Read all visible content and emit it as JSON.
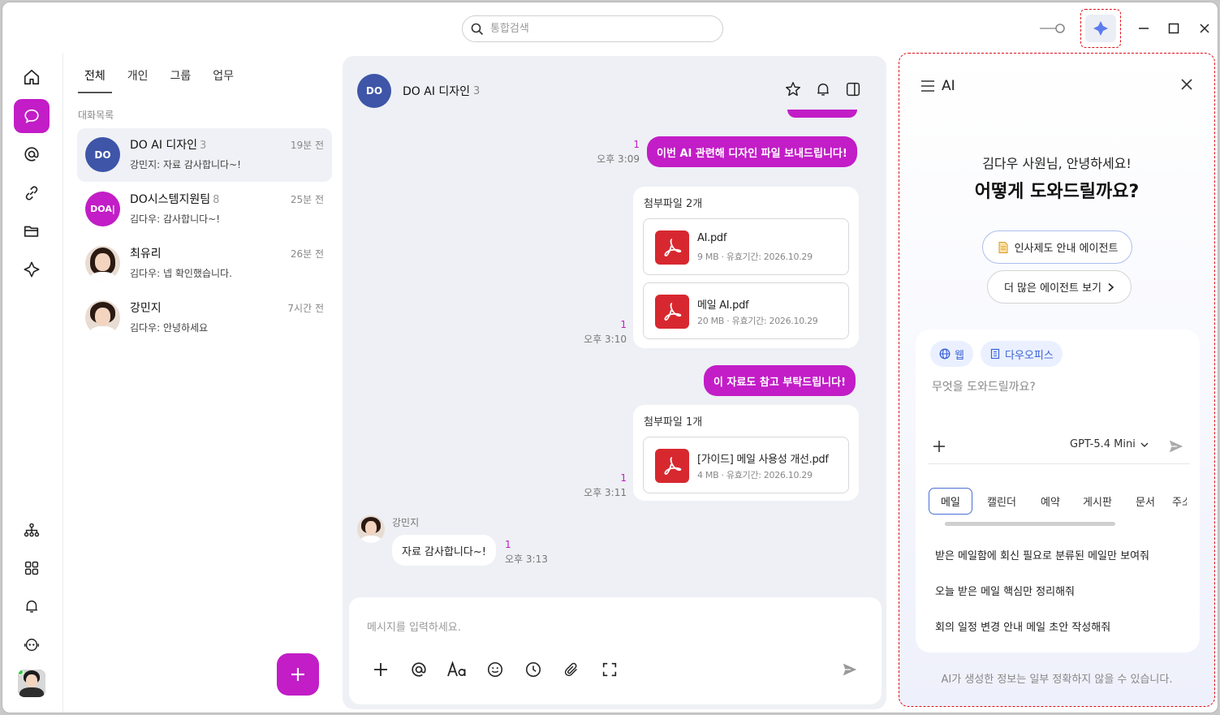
{
  "search": {
    "placeholder": "통합검색"
  },
  "list": {
    "tabs": [
      "전체",
      "개인",
      "그룹",
      "업무"
    ],
    "section_label": "대화목록",
    "conversations": [
      {
        "name": "DO AI 디자인",
        "count": "3",
        "preview": "강민지: 자료 감사합니다~!",
        "time": "19분 전",
        "avatar": "DO",
        "color": "#3e55a8"
      },
      {
        "name": "DO시스템지원팀",
        "count": "8",
        "preview": "김다우: 감사합니다~!",
        "time": "25분 전",
        "avatar": "DOA|",
        "color": "#c21dc7"
      },
      {
        "name": "최유리",
        "count": "",
        "preview": "김다우: 넵 확인했습니다.",
        "time": "26분 전"
      },
      {
        "name": "강민지",
        "count": "",
        "preview": "김다우: 안녕하세요",
        "time": "7시간 전"
      }
    ]
  },
  "chat": {
    "avatar": "DO",
    "title": "DO AI 디자인",
    "member_count": "3",
    "messages": {
      "m1": {
        "text": "이번 AI 관련해 디자인 파일 보내드립니다!",
        "read": "1",
        "time": "오후 3:09"
      },
      "a1": {
        "header": "첨부파일 2개",
        "read": "1",
        "time": "오후 3:10",
        "files": [
          {
            "name": "AI.pdf",
            "info": "9 MB · 유효기간: 2026.10.29"
          },
          {
            "name": "메일 AI.pdf",
            "info": "20 MB · 유효기간: 2026.10.29"
          }
        ]
      },
      "m2": {
        "text": "이 자료도 참고 부탁드립니다!"
      },
      "a2": {
        "header": "첨부파일 1개",
        "read": "1",
        "time": "오후 3:11",
        "files": [
          {
            "name": "[가이드] 메일 사용성 개선.pdf",
            "info": "4 MB · 유효기간: 2026.10.29"
          }
        ]
      },
      "m3": {
        "sender": "강민지",
        "text": "자료 감사합니다~!",
        "read": "1",
        "time": "오후 3:13"
      }
    },
    "composer_placeholder": "메시지를 입력하세요."
  },
  "ai": {
    "title": "AI",
    "greeting_line1": "김다우 사원님, 안녕하세요!",
    "greeting_line2": "어떻게 도와드릴까요?",
    "agent_button": "인사제도 안내 에이전트",
    "more_agents": "더 많은 에이전트 보기",
    "chips": [
      "웹",
      "다우오피스"
    ],
    "input_placeholder": "무엇을 도와드릴까요?",
    "model": "GPT-5.4 Mini",
    "categories": [
      "메일",
      "캘린더",
      "예약",
      "게시판",
      "문서",
      "주소"
    ],
    "suggestions": [
      "받은 메일함에 회신 필요로 분류된 메일만 보여줘",
      "오늘 받은 메일 핵심만 정리해줘",
      "회의 일정 변경 안내 메일 초안 작성해줘"
    ],
    "disclaimer": "AI가 생성한 정보는 일부 정확하지 않을 수 있습니다."
  },
  "colors": {
    "accent": "#c21dc7",
    "ai_blue": "#4b6fd6",
    "highlight_frame": "#e0121a"
  }
}
